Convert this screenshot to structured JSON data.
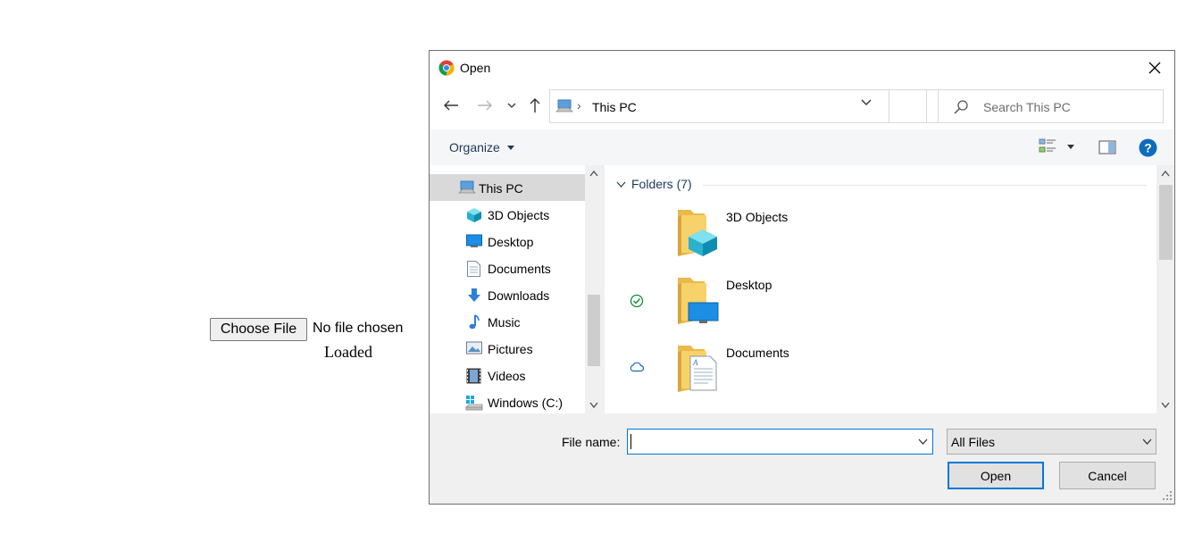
{
  "page": {
    "choose_file_label": "Choose File",
    "no_file_text": "No file chosen",
    "status_text": "Loaded"
  },
  "dialog": {
    "title": "Open",
    "address": {
      "location": "This PC"
    },
    "search": {
      "placeholder": "Search This PC"
    },
    "toolbar": {
      "organize_label": "Organize"
    },
    "nav_items": [
      {
        "label": "This PC",
        "icon": "this-pc-icon",
        "selected": true
      },
      {
        "label": "3D Objects",
        "icon": "3d-objects-icon"
      },
      {
        "label": "Desktop",
        "icon": "desktop-icon"
      },
      {
        "label": "Documents",
        "icon": "documents-icon"
      },
      {
        "label": "Downloads",
        "icon": "downloads-icon"
      },
      {
        "label": "Music",
        "icon": "music-icon"
      },
      {
        "label": "Pictures",
        "icon": "pictures-icon"
      },
      {
        "label": "Videos",
        "icon": "videos-icon"
      },
      {
        "label": "Windows (C:)",
        "icon": "drive-icon"
      }
    ],
    "group_header": "Folders (7)",
    "folders": [
      {
        "name": "3D Objects",
        "status": ""
      },
      {
        "name": "Desktop",
        "status": "synced-check-icon"
      },
      {
        "name": "Documents",
        "status": "cloud-icon"
      },
      {
        "name": "",
        "status": ""
      }
    ],
    "bottom": {
      "file_name_label": "File name:",
      "file_name_value": "",
      "file_type": "All Files",
      "open_label": "Open",
      "cancel_label": "Cancel"
    },
    "colors": {
      "accent": "#0078d7",
      "link_text": "#1e395b",
      "folder_yellow": "#f7d26a"
    }
  }
}
